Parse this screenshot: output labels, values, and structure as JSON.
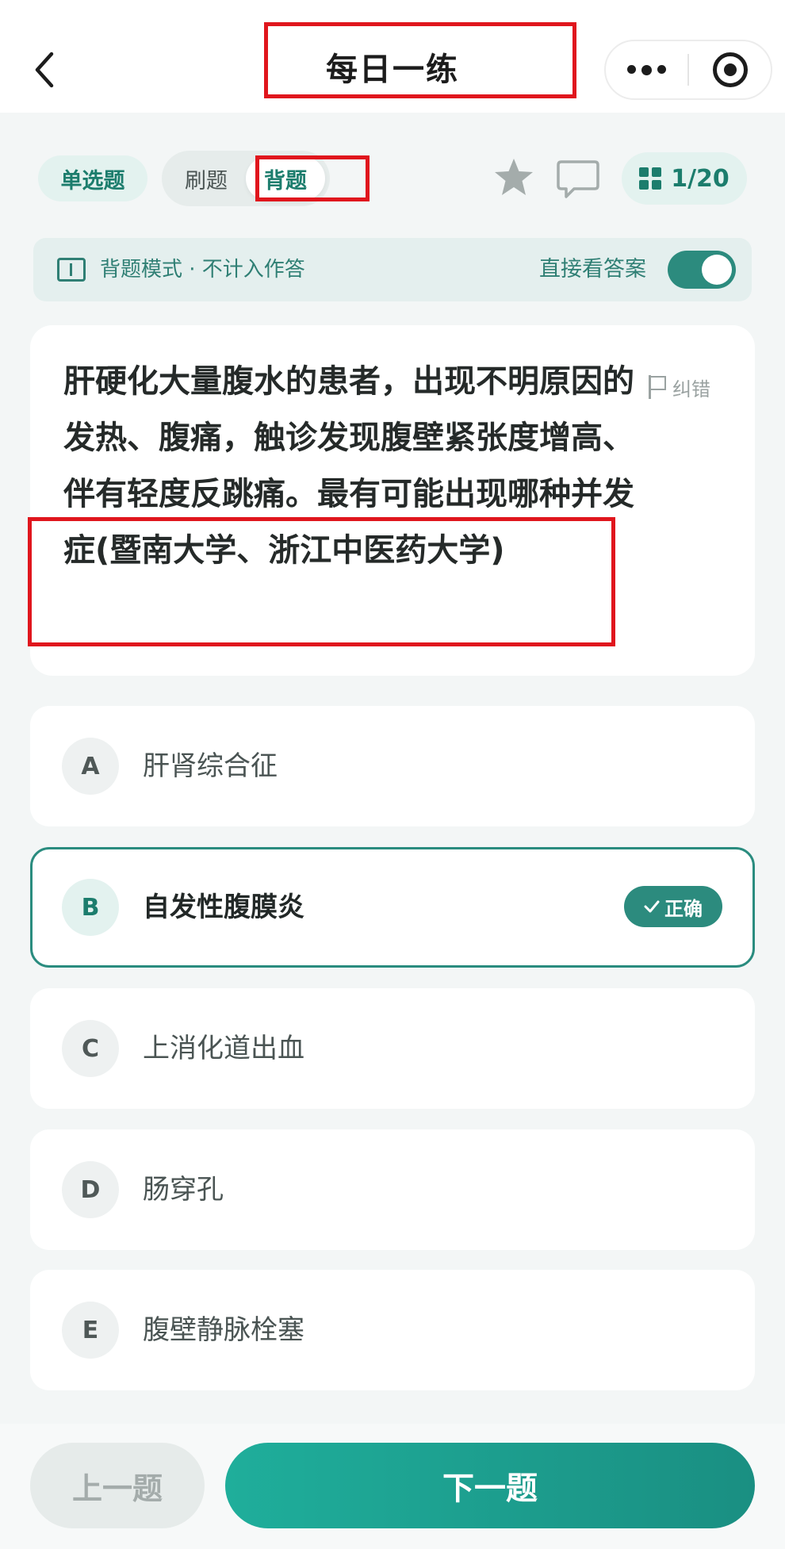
{
  "header": {
    "title": "每日一练"
  },
  "mode_row": {
    "question_type": "单选题",
    "modes": [
      "刷题",
      "背题"
    ],
    "active_mode": "背题",
    "progress": "1/20"
  },
  "notice": {
    "text": "背题模式 · 不计入作答",
    "toggle_label": "直接看答案",
    "toggle_on": true
  },
  "question": {
    "text": "肝硬化大量腹水的患者，出现不明原因的发热、腹痛，触诊发现腹壁紧张度增高、伴有轻度反跳痛。最有可能出现哪种并发症(暨南大学、浙江中医药大学)",
    "report_label": "纠错"
  },
  "options": [
    {
      "letter": "A",
      "text": "肝肾综合征",
      "correct": false
    },
    {
      "letter": "B",
      "text": "自发性腹膜炎",
      "correct": true
    },
    {
      "letter": "C",
      "text": "上消化道出血",
      "correct": false
    },
    {
      "letter": "D",
      "text": "肠穿孔",
      "correct": false
    },
    {
      "letter": "E",
      "text": "腹壁静脉栓塞",
      "correct": false
    }
  ],
  "correct_badge": "正确",
  "nav": {
    "prev": "上一题",
    "next": "下一题"
  },
  "colors": {
    "accent": "#2c8b7e",
    "highlight_box": "#e0161d"
  }
}
